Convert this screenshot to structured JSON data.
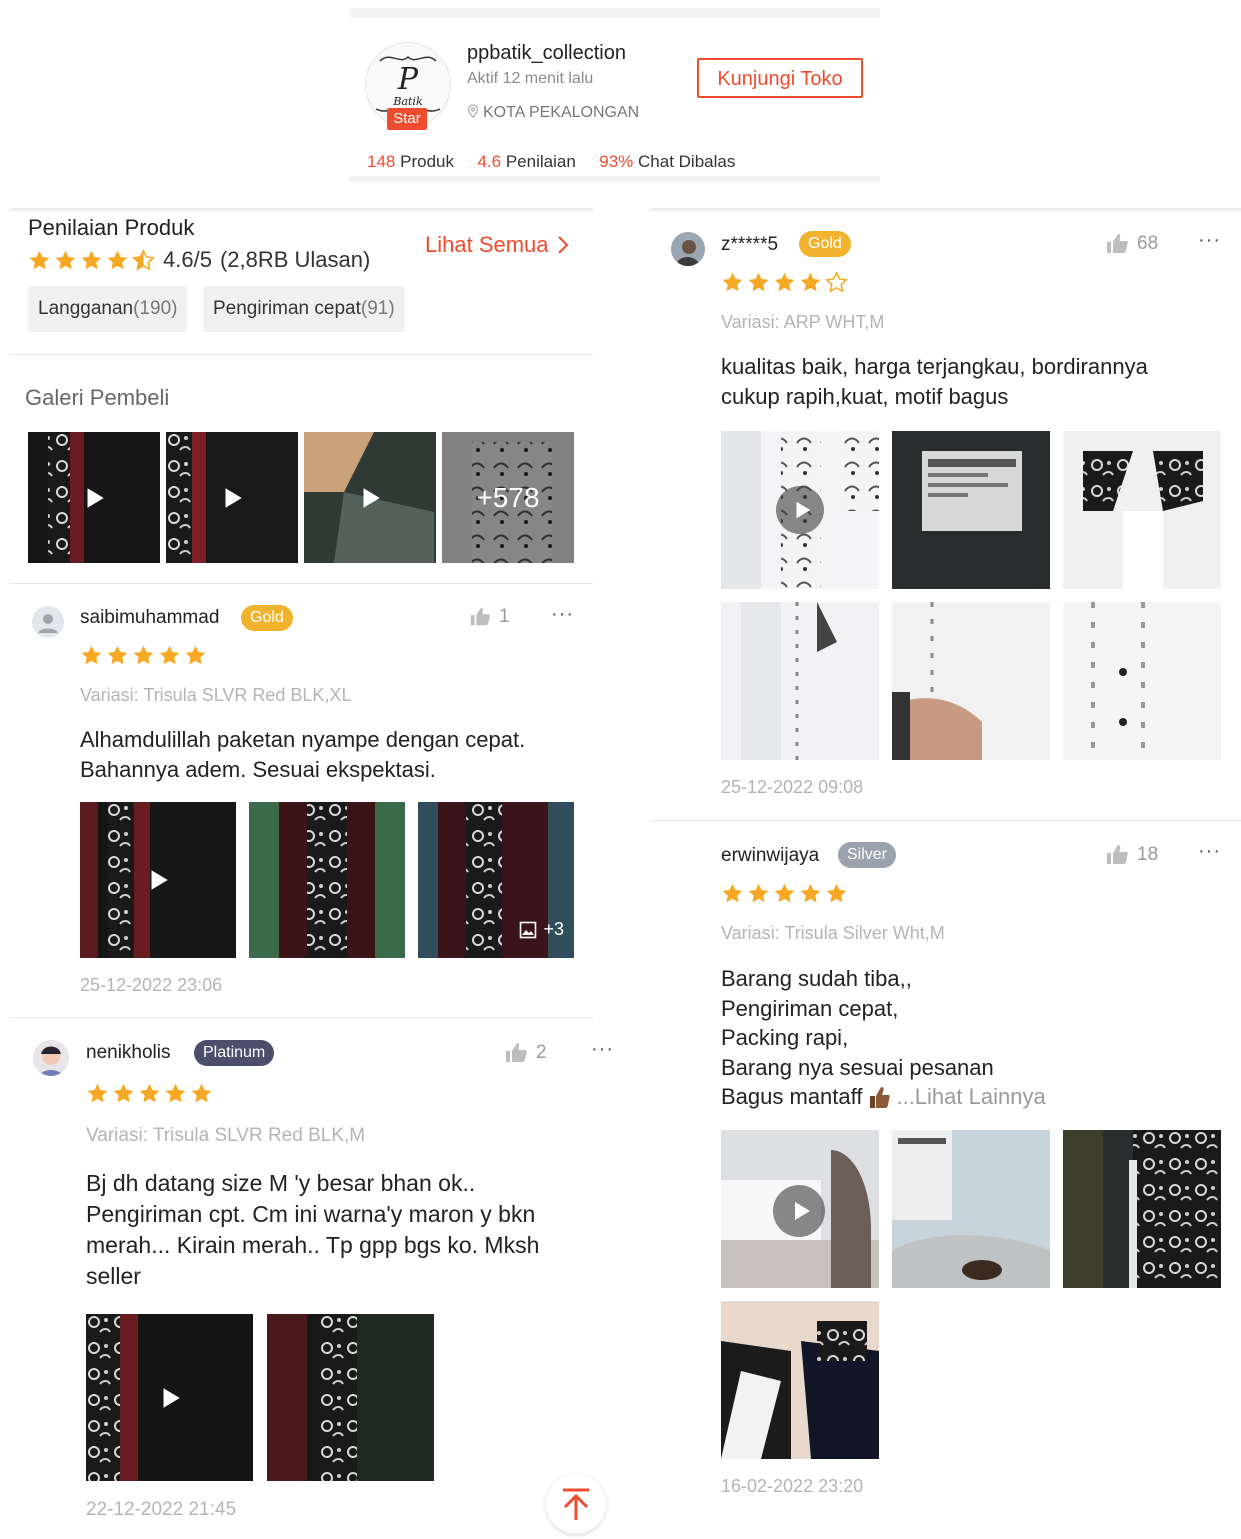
{
  "shop": {
    "name": "ppbatik_collection",
    "active": "Aktif 12 menit lalu",
    "location": "KOTA PEKALONGAN",
    "badge": "Star",
    "visit_label": "Kunjungi Toko",
    "stats": [
      {
        "num": "148",
        "label": "Produk"
      },
      {
        "num": "4.6",
        "label": "Penilaian"
      },
      {
        "num": "93%",
        "label": "Chat Dibalas"
      }
    ]
  },
  "ratings": {
    "title": "Penilaian Produk",
    "score": "4.6/5",
    "count": "(2,8RB Ulasan)",
    "see_all": "Lihat Semua",
    "filters": [
      {
        "label": "Langganan",
        "count": "(190)"
      },
      {
        "label": "Pengiriman cepat",
        "count": "(91)"
      }
    ]
  },
  "gallery": {
    "title": "Galeri Pembeli",
    "more": "+578"
  },
  "reviews": [
    {
      "user": "saibimuhammad",
      "badge": "Gold",
      "likes": "1",
      "stars": 5,
      "variant": "Variasi: Trisula SLVR Red BLK,XL",
      "comment_lines": [
        "Alhamdulillah paketan nyampe dengan cepat.",
        "Bahannya adem. Sesuai ekspektasi."
      ],
      "more_photos": "+3",
      "date": "25-12-2022 23:06"
    },
    {
      "user": "nenikholis",
      "badge": "Platinum",
      "likes": "2",
      "stars": 5,
      "variant": "Variasi: Trisula SLVR Red BLK,M",
      "comment_lines": [
        "Bj dh datang size M 'y besar bhan ok..",
        "Pengiriman cpt. Cm ini warna'y maron y bkn",
        "merah... Kirain merah.. Tp gpp bgs ko. Mksh",
        "seller"
      ],
      "date": "22-12-2022 21:45"
    },
    {
      "user": "z*****5",
      "badge": "Gold",
      "likes": "68",
      "stars": 4,
      "variant": "Variasi: ARP WHT,M",
      "comment_lines": [
        "kualitas baik, harga terjangkau, bordirannya",
        "cukup rapih,kuat, motif bagus"
      ],
      "date": "25-12-2022 09:08"
    },
    {
      "user": "erwinwijaya",
      "badge": "Silver",
      "likes": "18",
      "stars": 5,
      "variant": "Variasi: Trisula Silver Wht,M",
      "comment_lines": [
        "Barang sudah tiba,,",
        "Pengiriman cepat,",
        "Packing rapi,",
        "Barang nya sesuai pesanan",
        "Bagus mantaff"
      ],
      "see_more": "...Lihat Lainnya",
      "date": "16-02-2022 23:20"
    }
  ],
  "colors": {
    "accent": "#ee4d2d",
    "star": "#f7a823",
    "gold": "#f1b32d",
    "platinum": "#4c4f6b",
    "silver": "#9aa3ad"
  }
}
